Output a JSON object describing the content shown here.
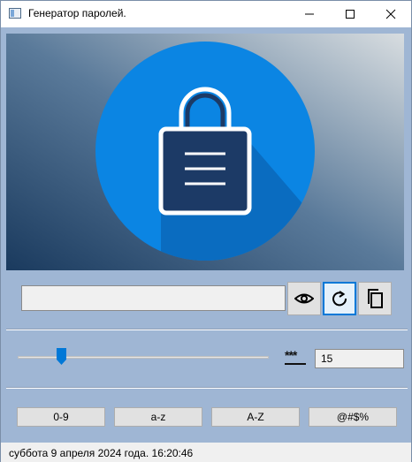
{
  "window": {
    "title": "Генератор паролей.",
    "controls": [
      "minimize-icon",
      "maximize-icon",
      "close-icon"
    ]
  },
  "banner": {
    "icon": "padlock-icon",
    "colors": {
      "circle": "#0b85e3",
      "lock": "#1c3a66",
      "outline": "#ffffff"
    }
  },
  "password": {
    "value": "",
    "buttons": [
      "eye-icon",
      "refresh-icon",
      "copy-icon"
    ]
  },
  "length": {
    "stars_label": "***",
    "value": "15",
    "slider_level": 0.16
  },
  "charsets": {
    "digits": "0-9",
    "lower": "a-z",
    "upper": "A-Z",
    "symbols": "@#$%"
  },
  "status": {
    "datetime": "суббота 9 апреля 2024 года. 16:20:46"
  },
  "accent": "#0078d7"
}
